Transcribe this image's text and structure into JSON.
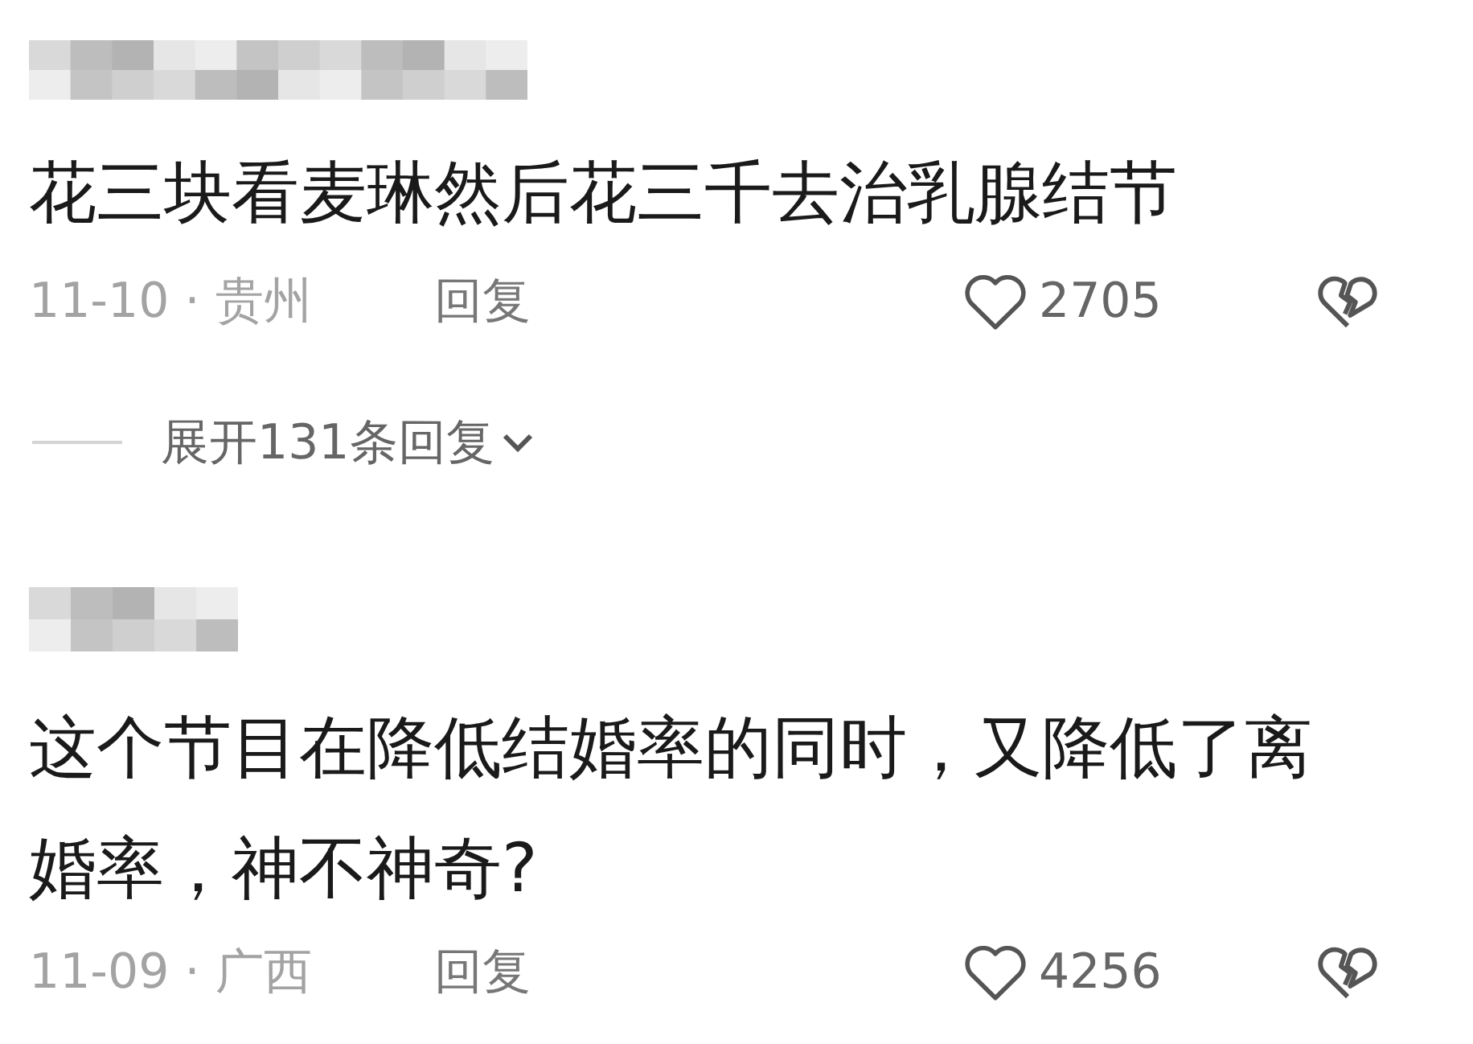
{
  "comments": [
    {
      "text": "花三块看麦琳然后花三千去治乳腺结节",
      "meta": "11-10 · 贵州",
      "reply": "回复",
      "likes": "2705",
      "expand": "展开131条回复",
      "kind": "long-name"
    },
    {
      "text": "这个节目在降低结婚率的同时，又降低了离婚率，神不神奇?",
      "meta": "11-09 · 广西",
      "reply": "回复",
      "likes": "4256",
      "kind": "short-name"
    }
  ]
}
